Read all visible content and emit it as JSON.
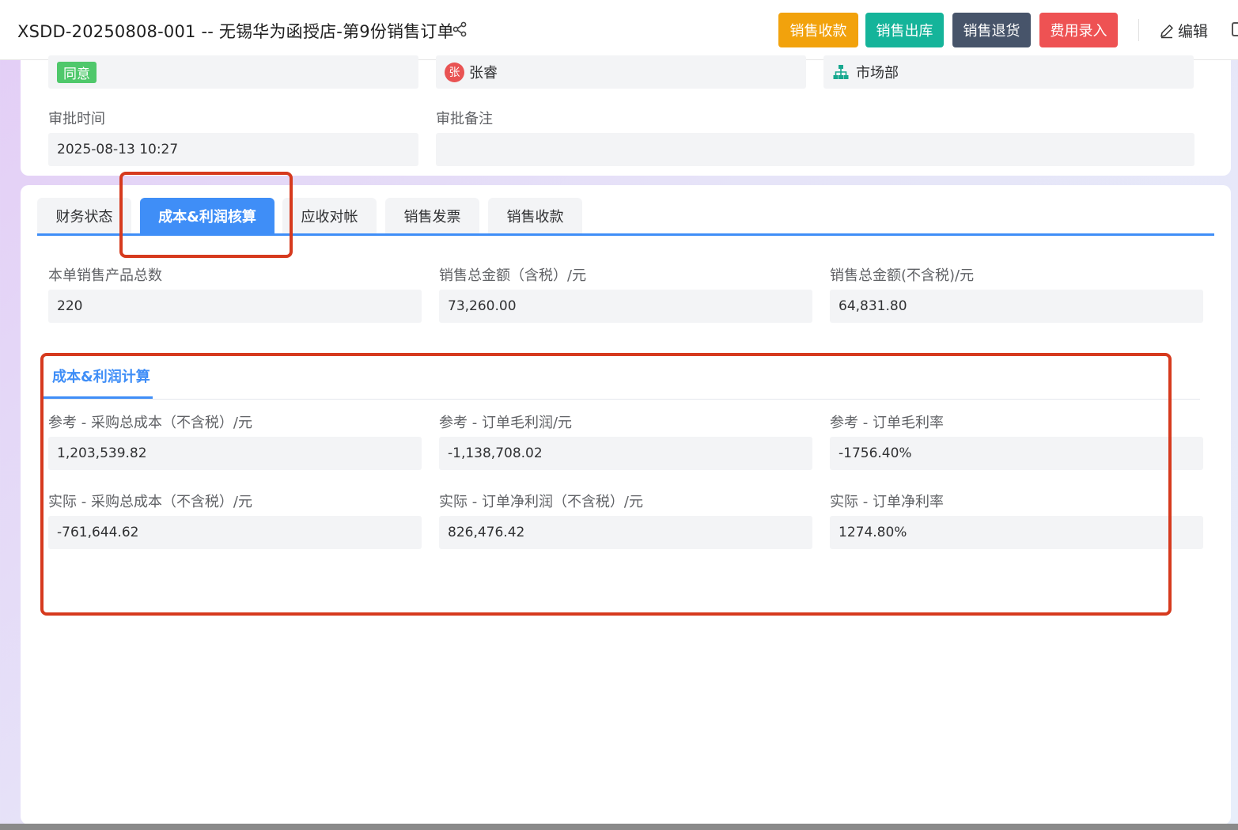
{
  "header": {
    "title": "XSDD-20250808-001 -- 无锡华为函授店-第9份销售订单",
    "buttons": {
      "sales_receipt": "销售收款",
      "sales_outbound": "销售出库",
      "sales_return": "销售退货",
      "expense_entry": "费用录入"
    },
    "edit_label": "编辑"
  },
  "approval": {
    "status_tag": "同意",
    "approver": "张睿",
    "approver_avatar": "张",
    "department": "市场部",
    "time_label": "审批时间",
    "time_value": "2025-08-13 10:27",
    "remark_label": "审批备注",
    "remark_value": ""
  },
  "tabs": [
    "财务状态",
    "成本&利润核算",
    "应收对帐",
    "销售发票",
    "销售收款"
  ],
  "active_tab": 1,
  "summary": {
    "total_products_label": "本单销售产品总数",
    "total_products_value": "220",
    "total_amount_tax_label": "销售总金额（含税）/元",
    "total_amount_tax_value": "73,260.00",
    "total_amount_notax_label": "销售总金额(不含税)/元",
    "total_amount_notax_value": "64,831.80"
  },
  "cost_profit": {
    "subtab_label": "成本&利润计算",
    "ref_cost_label": "参考 - 采购总成本（不含税）/元",
    "ref_cost_value": "1,203,539.82",
    "ref_profit_label": "参考 - 订单毛利润/元",
    "ref_profit_value": "-1,138,708.02",
    "ref_margin_label": "参考 - 订单毛利率",
    "ref_margin_value": "-1756.40%",
    "act_cost_label": "实际 - 采购总成本（不含税）/元",
    "act_cost_value": "-761,644.62",
    "act_profit_label": "实际 - 订单净利润（不含税）/元",
    "act_profit_value": "826,476.42",
    "act_margin_label": "实际 - 订单净利率",
    "act_margin_value": "1274.80%"
  },
  "colors": {
    "accent": "#3f8ef7",
    "annotation": "#d63a1e",
    "btn_receipt": "#f2a20c",
    "btn_outbound": "#15b49a",
    "btn_return": "#47546a",
    "btn_expense": "#ee5253"
  },
  "icons": [
    "share-icon",
    "edit-icon",
    "org-tree-icon"
  ]
}
